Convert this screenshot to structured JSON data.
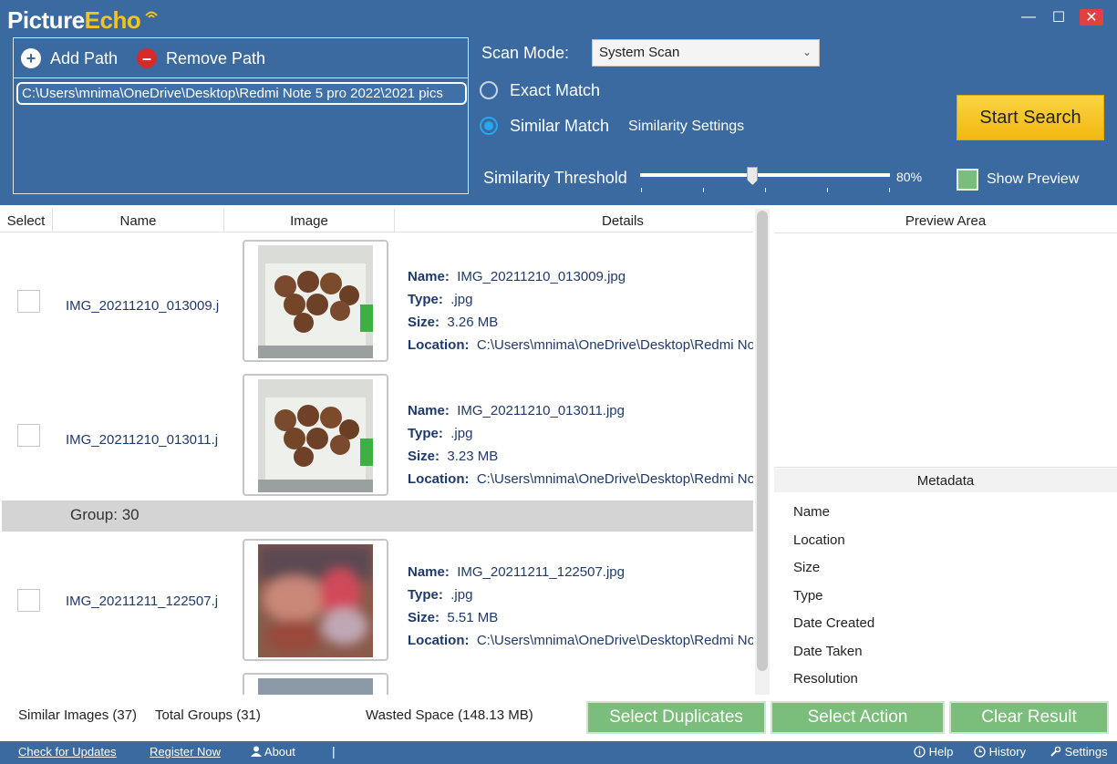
{
  "app": {
    "logo_part1": "Picture",
    "logo_part2": "Echo",
    "window_controls": {
      "minimize": "—",
      "maximize": "☐",
      "close": "✕"
    }
  },
  "paths": {
    "add_label": "Add Path",
    "remove_label": "Remove Path",
    "items": [
      "C:\\Users\\mnima\\OneDrive\\Desktop\\Redmi Note 5 pro 2022\\2021 pics"
    ]
  },
  "scan": {
    "mode_label": "Scan Mode:",
    "mode_value": "System Scan",
    "exact_label": "Exact Match",
    "similar_label": "Similar Match",
    "selected": "Similar Match",
    "similarity_settings_label": "Similarity Settings",
    "threshold_label": "Similarity Threshold",
    "threshold_value": 80,
    "threshold_text": "80%",
    "show_preview_label": "Show Preview",
    "start_label": "Start Search"
  },
  "list": {
    "headers": {
      "select": "Select",
      "name": "Name",
      "image": "Image",
      "details": "Details"
    },
    "detail_labels": {
      "name": "Name:",
      "type": "Type:",
      "size": "Size:",
      "location": "Location:"
    },
    "rows": [
      {
        "short_name": "IMG_20211210_013009.j",
        "name": "IMG_20211210_013009.jpg",
        "type": ".jpg",
        "size": "3.26 MB",
        "location": "C:\\Users\\mnima\\OneDrive\\Desktop\\Redmi No"
      },
      {
        "short_name": "IMG_20211210_013011.j",
        "name": "IMG_20211210_013011.jpg",
        "type": ".jpg",
        "size": "3.23 MB",
        "location": "C:\\Users\\mnima\\OneDrive\\Desktop\\Redmi No"
      },
      {
        "short_name": "IMG_20211211_122507.j",
        "name": "IMG_20211211_122507.jpg",
        "type": ".jpg",
        "size": "5.51 MB",
        "location": "C:\\Users\\mnima\\OneDrive\\Desktop\\Redmi No"
      }
    ],
    "group_label": "Group: 30"
  },
  "preview": {
    "title": "Preview Area",
    "metadata_title": "Metadata",
    "metadata_fields": [
      "Name",
      "Location",
      "Size",
      "Type",
      "Date Created",
      "Date Taken",
      "Resolution"
    ]
  },
  "stats": {
    "similar_images": "Similar Images (37)",
    "total_groups": "Total Groups (31)",
    "wasted_space": "Wasted Space (148.13 MB)"
  },
  "actions": {
    "select_duplicates": "Select Duplicates",
    "select_action": "Select Action",
    "clear_result": "Clear Result"
  },
  "statusbar": {
    "check_updates": "Check for Updates",
    "register": "Register Now",
    "about": "About",
    "help": "Help",
    "history": "History",
    "settings": "Settings"
  },
  "colors": {
    "header_blue": "#3a6aa0",
    "start_yellow": "#f4c419",
    "action_green": "#7bbd7a"
  }
}
